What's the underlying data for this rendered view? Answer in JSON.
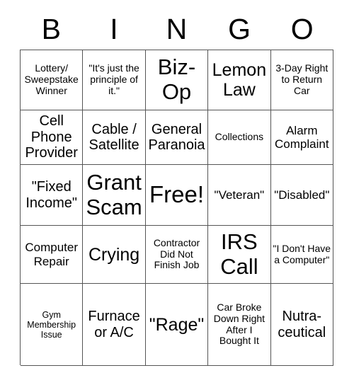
{
  "card": {
    "title_letters": [
      "B",
      "I",
      "N",
      "G",
      "O"
    ],
    "rows": [
      [
        {
          "text": "Lottery/ Sweepstake Winner"
        },
        {
          "text": "\"It's just the principle of it.\""
        },
        {
          "text": "Biz-Op"
        },
        {
          "text": "Lemon Law"
        },
        {
          "text": "3-Day Right to Return Car"
        }
      ],
      [
        {
          "text": "Cell Phone Provider"
        },
        {
          "text": "Cable / Satellite"
        },
        {
          "text": "General Paranoia"
        },
        {
          "text": "Collections"
        },
        {
          "text": "Alarm Complaint"
        }
      ],
      [
        {
          "text": "\"Fixed Income\""
        },
        {
          "text": "Grant Scam"
        },
        {
          "text": "Free!"
        },
        {
          "text": "\"Veteran\""
        },
        {
          "text": "\"Disabled\""
        }
      ],
      [
        {
          "text": "Computer Repair"
        },
        {
          "text": "Crying"
        },
        {
          "text": "Contractor Did Not Finish Job"
        },
        {
          "text": "IRS Call"
        },
        {
          "text": "\"I Don't Have a Computer\""
        }
      ],
      [
        {
          "text": "Gym Membership Issue"
        },
        {
          "text": "Furnace or A/C"
        },
        {
          "text": "\"Rage\""
        },
        {
          "text": "Car Broke Down Right After I Bought It"
        },
        {
          "text": "Nutra-ceutical"
        }
      ]
    ]
  },
  "style": {
    "background_color": "#ffffff",
    "text_color": "#000000",
    "border_color": "#555555"
  }
}
